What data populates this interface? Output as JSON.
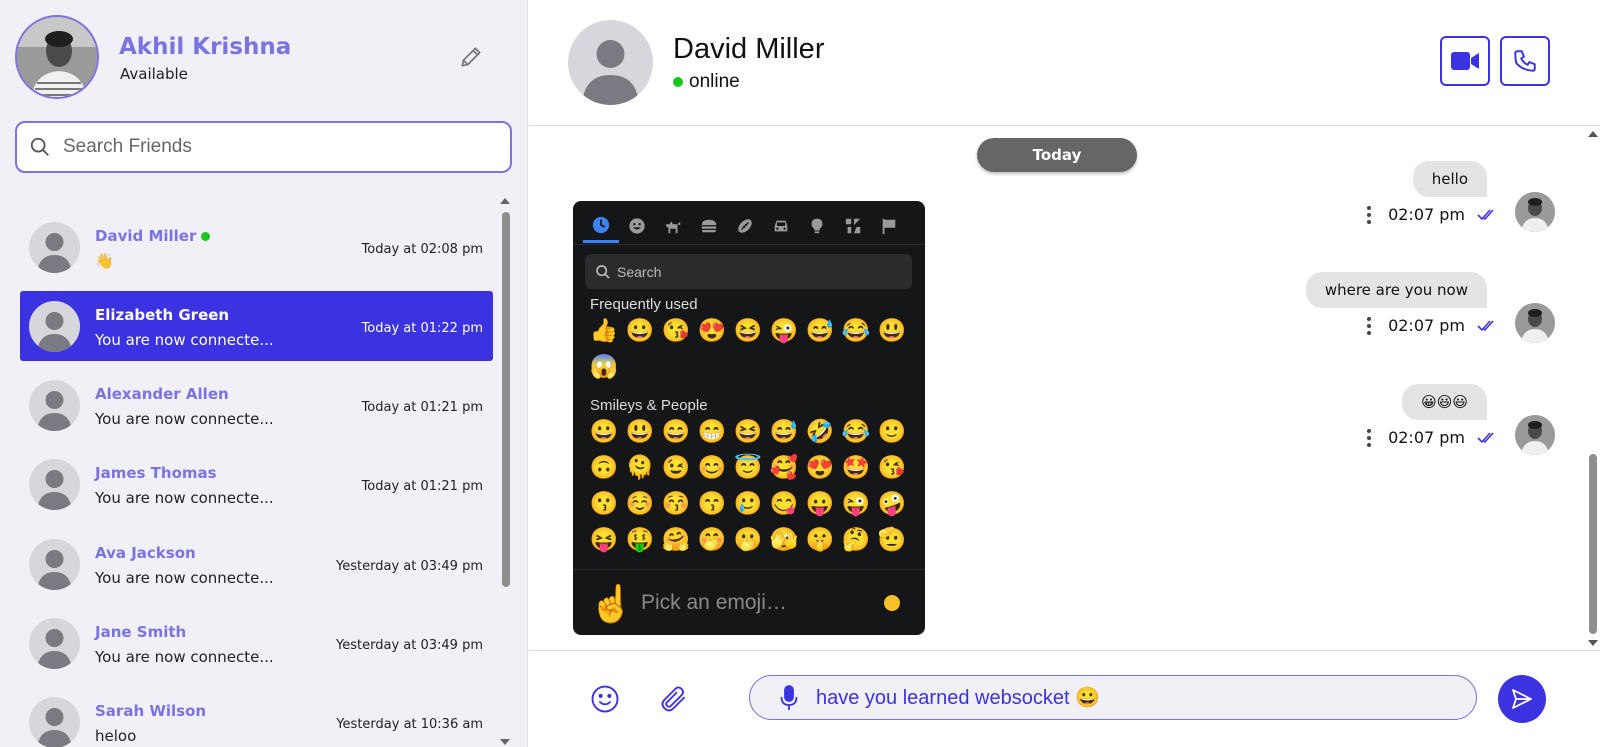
{
  "profile": {
    "name": "Akhil Krishna",
    "status": "Available"
  },
  "search": {
    "placeholder": "Search Friends"
  },
  "friends": [
    {
      "name": "David Miller",
      "online": true,
      "last_message": "👋",
      "time": "Today at 02:08 pm",
      "active": false
    },
    {
      "name": "Elizabeth Green",
      "online": false,
      "last_message": "You are now connecte...",
      "time": "Today at 01:22 pm",
      "active": true
    },
    {
      "name": "Alexander Allen",
      "online": false,
      "last_message": "You are now connecte...",
      "time": "Today at 01:21 pm",
      "active": false
    },
    {
      "name": "James Thomas",
      "online": false,
      "last_message": "You are now connecte...",
      "time": "Today at 01:21 pm",
      "active": false
    },
    {
      "name": "Ava Jackson",
      "online": false,
      "last_message": "You are now connecte...",
      "time": "Yesterday at 03:49 pm",
      "active": false
    },
    {
      "name": "Jane Smith",
      "online": false,
      "last_message": "You are now connecte...",
      "time": "Yesterday at 03:49 pm",
      "active": false
    },
    {
      "name": "Sarah Wilson",
      "online": false,
      "last_message": "heloo",
      "time": "Yesterday at 10:36 am",
      "active": false
    }
  ],
  "chat_header": {
    "contact_name": "David Miller",
    "contact_status": "online",
    "video_icon": "video-camera-icon",
    "call_icon": "phone-icon"
  },
  "messages": {
    "date_divider": "Today",
    "items": [
      {
        "text": "hello",
        "time": "02:07 pm",
        "status": "read"
      },
      {
        "text": "where are you now",
        "time": "02:07 pm",
        "status": "read"
      },
      {
        "text": "😀😃😃",
        "time": "02:07 pm",
        "status": "read"
      }
    ]
  },
  "emoji_picker": {
    "categories": [
      "recent-icon",
      "smiley-icon",
      "animal-icon",
      "food-icon",
      "activity-icon",
      "travel-icon",
      "object-icon",
      "symbol-icon",
      "flag-icon"
    ],
    "search_placeholder": "Search",
    "sections": [
      {
        "title": "Frequently used",
        "emojis": [
          "👍",
          "😀",
          "😘",
          "😍",
          "😆",
          "😜",
          "😅",
          "😂",
          "😃",
          "😱"
        ]
      },
      {
        "title": "Smileys & People",
        "emojis": [
          "😀",
          "😃",
          "😄",
          "😁",
          "😆",
          "😅",
          "🤣",
          "😂",
          "🙂",
          "🙃",
          "🫠",
          "😉",
          "😊",
          "😇",
          "🥰",
          "😍",
          "🤩",
          "😘",
          "😗",
          "☺️",
          "😚",
          "😙",
          "🥲",
          "😋",
          "😛",
          "😜",
          "🤪",
          "😝",
          "🤑",
          "🤗",
          "🤭",
          "🫢",
          "🫣",
          "🤫",
          "🤔",
          "🫡"
        ]
      }
    ],
    "preview_emoji": "☝️",
    "preview_placeholder": "Pick an emoji…",
    "skin_tone_color": "#f6c128"
  },
  "composer": {
    "input_value": "have you learned websocket 😀",
    "emoji_icon": "smiley-icon",
    "attach_icon": "paperclip-icon",
    "mic_icon": "microphone-icon",
    "send_icon": "send-icon"
  },
  "colors": {
    "accent": "#3b32e0",
    "brand_light": "#7b73e0",
    "online": "#19c81b",
    "sidebar_bg": "#f1f0f6"
  }
}
